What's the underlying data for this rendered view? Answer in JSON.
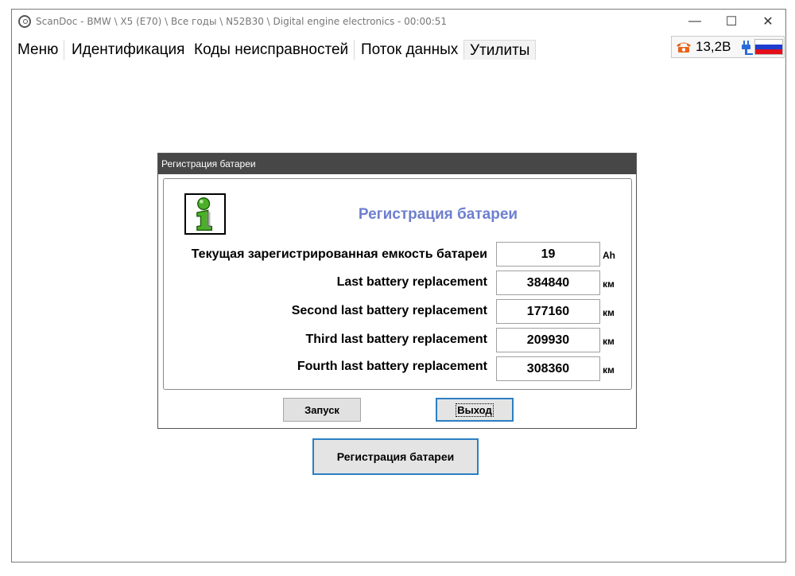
{
  "window": {
    "title": "ScanDoc - BMW \\ X5 (E70) \\ Все годы \\ N52B30 \\ Digital engine electronics - 00:00:51",
    "controls": {
      "minimize": "—",
      "maximize": "☐",
      "close": "✕"
    }
  },
  "menu": {
    "tabs": [
      {
        "label": "Меню"
      },
      {
        "label": "Идентификация"
      },
      {
        "label": "Коды неисправностей"
      },
      {
        "label": "Поток данных"
      },
      {
        "label": "Утилиты"
      }
    ],
    "active_tab": "Утилиты"
  },
  "status": {
    "voltage": "13,2В",
    "phone_icon": "phone-icon",
    "plug_icon": "plug-icon",
    "flag": "russia-flag",
    "colors": {
      "phone": "#e8641b",
      "plug": "#2a6ad8",
      "flag_white": "#ffffff",
      "flag_blue": "#1c3fd0",
      "flag_red": "#e30f1b"
    }
  },
  "main_button": {
    "label": "Регистрация батареи"
  },
  "dialog": {
    "title": "Регистрация батареи",
    "heading": "Регистрация батареи",
    "heading_color": "#6e7fcf",
    "rows": [
      {
        "label": "Текущая зарегистрированная емкость батареи",
        "value": "19",
        "unit": "Ah"
      },
      {
        "label": "Last battery replacement",
        "value": "384840",
        "unit": "км"
      },
      {
        "label": "Second last battery replacement",
        "value": "177160",
        "unit": "км"
      },
      {
        "label": "Third last battery replacement",
        "value": "209930",
        "unit": "км"
      },
      {
        "label": "Fourth last battery replacement",
        "value": "308360",
        "unit": "км"
      }
    ],
    "buttons": {
      "start": "Запуск",
      "exit": "Выход"
    }
  }
}
